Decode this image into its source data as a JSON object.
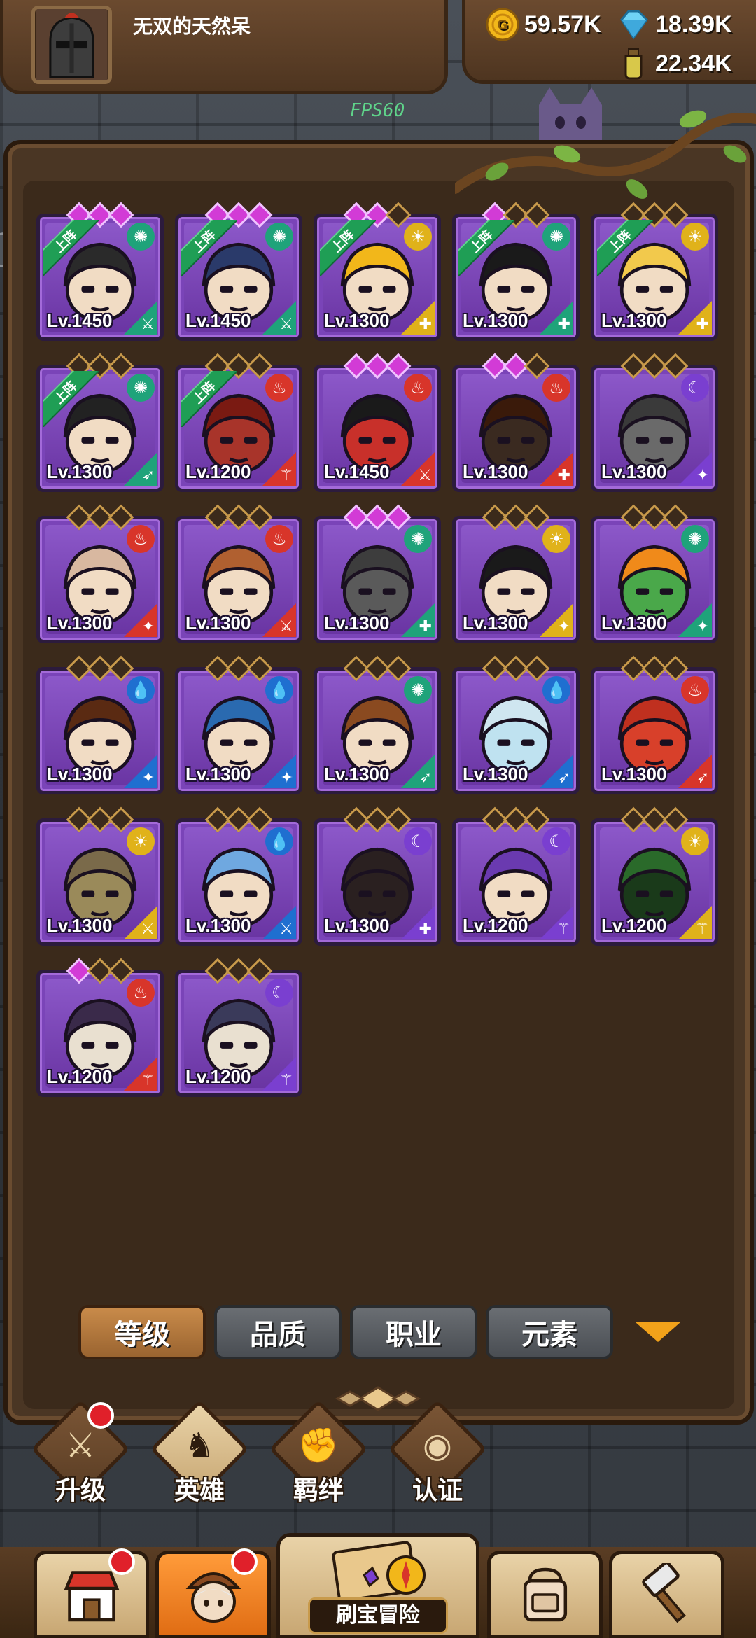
{
  "header": {
    "player_name": "无双的天然呆",
    "fps_label": "FPS60",
    "side_counter": "22",
    "currencies": [
      {
        "name": "gold",
        "value": "59.57K",
        "color": "#f2b71a"
      },
      {
        "name": "diamond",
        "value": "18.39K",
        "color": "#6fd3f5"
      },
      {
        "name": "potion",
        "value": "22.34K",
        "color": "#d8c84a"
      }
    ]
  },
  "heroes": [
    {
      "level": "Lv.1450",
      "stars_lit": 3,
      "deployed": true,
      "deploy_label": "上阵",
      "element": "wind",
      "element_color": "#1fa37a",
      "class": "sword",
      "class_color": "#1fa37a",
      "face": "dark-hair-man"
    },
    {
      "level": "Lv.1450",
      "stars_lit": 3,
      "deployed": true,
      "deploy_label": "上阵",
      "element": "wind",
      "element_color": "#1fa37a",
      "class": "sword",
      "class_color": "#1fa37a",
      "face": "pirate"
    },
    {
      "level": "Lv.1300",
      "stars_lit": 2,
      "deployed": true,
      "deploy_label": "上阵",
      "element": "light",
      "element_color": "#e0b21a",
      "class": "shield",
      "class_color": "#e0b21a",
      "face": "king"
    },
    {
      "level": "Lv.1300",
      "stars_lit": 1,
      "deployed": true,
      "deploy_label": "上阵",
      "element": "wind",
      "element_color": "#1fa37a",
      "class": "shield",
      "class_color": "#1fa37a",
      "face": "headband"
    },
    {
      "level": "Lv.1300",
      "stars_lit": 0,
      "deployed": true,
      "deploy_label": "上阵",
      "element": "light",
      "element_color": "#e0b21a",
      "class": "shield",
      "class_color": "#e0b21a",
      "face": "blonde"
    },
    {
      "level": "Lv.1300",
      "stars_lit": 0,
      "deployed": true,
      "deploy_label": "上阵",
      "element": "wind",
      "element_color": "#1fa37a",
      "class": "bow",
      "class_color": "#1fa37a",
      "face": "ninja"
    },
    {
      "level": "Lv.1200",
      "stars_lit": 0,
      "deployed": true,
      "deploy_label": "上阵",
      "element": "fire",
      "element_color": "#d8352a",
      "class": "staff",
      "class_color": "#d8352a",
      "face": "red-demon"
    },
    {
      "level": "Lv.1450",
      "stars_lit": 3,
      "deployed": false,
      "deploy_label": "",
      "element": "fire",
      "element_color": "#d8352a",
      "class": "sword",
      "class_color": "#d8352a",
      "face": "devil"
    },
    {
      "level": "Lv.1300",
      "stars_lit": 2,
      "deployed": false,
      "deploy_label": "",
      "element": "fire",
      "element_color": "#d8352a",
      "class": "shield",
      "class_color": "#d8352a",
      "face": "afro"
    },
    {
      "level": "Lv.1300",
      "stars_lit": 0,
      "deployed": false,
      "deploy_label": "",
      "element": "dark",
      "element_color": "#7a3fd0",
      "class": "dagger",
      "class_color": "#7a3fd0",
      "face": "goat"
    },
    {
      "level": "Lv.1300",
      "stars_lit": 0,
      "deployed": false,
      "deploy_label": "",
      "element": "fire",
      "element_color": "#d8352a",
      "class": "dagger",
      "class_color": "#d8352a",
      "face": "bald-monk"
    },
    {
      "level": "Lv.1300",
      "stars_lit": 0,
      "deployed": false,
      "deploy_label": "",
      "element": "fire",
      "element_color": "#d8352a",
      "class": "sword",
      "class_color": "#d8352a",
      "face": "turban"
    },
    {
      "level": "Lv.1300",
      "stars_lit": 3,
      "deployed": false,
      "deploy_label": "",
      "element": "wind",
      "element_color": "#1fa37a",
      "class": "shield",
      "class_color": "#1fa37a",
      "face": "knight"
    },
    {
      "level": "Lv.1300",
      "stars_lit": 0,
      "deployed": false,
      "deploy_label": "",
      "element": "light",
      "element_color": "#e0b21a",
      "class": "dagger",
      "class_color": "#e0b21a",
      "face": "masked-king"
    },
    {
      "level": "Lv.1300",
      "stars_lit": 0,
      "deployed": false,
      "deploy_label": "",
      "element": "wind",
      "element_color": "#1fa37a",
      "class": "dagger",
      "class_color": "#1fa37a",
      "face": "orc"
    },
    {
      "level": "Lv.1300",
      "stars_lit": 0,
      "deployed": false,
      "deploy_label": "",
      "element": "water",
      "element_color": "#1f6fd0",
      "class": "dagger",
      "class_color": "#1f6fd0",
      "face": "bun-girl"
    },
    {
      "level": "Lv.1300",
      "stars_lit": 0,
      "deployed": false,
      "deploy_label": "",
      "element": "water",
      "element_color": "#1f6fd0",
      "class": "dagger",
      "class_color": "#1f6fd0",
      "face": "blue-hood"
    },
    {
      "level": "Lv.1300",
      "stars_lit": 0,
      "deployed": false,
      "deploy_label": "",
      "element": "wind",
      "element_color": "#1fa37a",
      "class": "bow",
      "class_color": "#1fa37a",
      "face": "elf"
    },
    {
      "level": "Lv.1300",
      "stars_lit": 0,
      "deployed": false,
      "deploy_label": "",
      "element": "water",
      "element_color": "#1f6fd0",
      "class": "bow",
      "class_color": "#1f6fd0",
      "face": "ice"
    },
    {
      "level": "Lv.1300",
      "stars_lit": 0,
      "deployed": false,
      "deploy_label": "",
      "element": "fire",
      "element_color": "#d8352a",
      "class": "bow",
      "class_color": "#d8352a",
      "face": "red-ogre"
    },
    {
      "level": "Lv.1300",
      "stars_lit": 0,
      "deployed": false,
      "deploy_label": "",
      "element": "light",
      "element_color": "#e0b21a",
      "class": "sword",
      "class_color": "#e0b21a",
      "face": "spartan"
    },
    {
      "level": "Lv.1300",
      "stars_lit": 0,
      "deployed": false,
      "deploy_label": "",
      "element": "water",
      "element_color": "#1f6fd0",
      "class": "sword",
      "class_color": "#1f6fd0",
      "face": "blue-hair"
    },
    {
      "level": "Lv.1300",
      "stars_lit": 0,
      "deployed": false,
      "deploy_label": "",
      "element": "dark",
      "element_color": "#7a3fd0",
      "class": "shield",
      "class_color": "#7a3fd0",
      "face": "dark-demon"
    },
    {
      "level": "Lv.1200",
      "stars_lit": 0,
      "deployed": false,
      "deploy_label": "",
      "element": "dark",
      "element_color": "#7a3fd0",
      "class": "staff",
      "class_color": "#7a3fd0",
      "face": "wizard"
    },
    {
      "level": "Lv.1200",
      "stars_lit": 0,
      "deployed": false,
      "deploy_label": "",
      "element": "light",
      "element_color": "#e0b21a",
      "class": "staff",
      "class_color": "#e0b21a",
      "face": "green-hood"
    },
    {
      "level": "Lv.1200",
      "stars_lit": 1,
      "deployed": false,
      "deploy_label": "",
      "element": "fire",
      "element_color": "#d8352a",
      "class": "staff",
      "class_color": "#d8352a",
      "face": "skull-hood"
    },
    {
      "level": "Lv.1200",
      "stars_lit": 0,
      "deployed": false,
      "deploy_label": "",
      "element": "dark",
      "element_color": "#7a3fd0",
      "class": "staff",
      "class_color": "#7a3fd0",
      "face": "dark-hood"
    }
  ],
  "filters": {
    "tabs": [
      "等级",
      "品质",
      "职业",
      "元素"
    ],
    "active_index": 0
  },
  "subnav": [
    {
      "label": "升级",
      "icon": "sword-upgrade-icon",
      "badge": true,
      "active": false
    },
    {
      "label": "英雄",
      "icon": "hero-icon",
      "badge": false,
      "active": true
    },
    {
      "label": "羁绊",
      "icon": "handshake-icon",
      "badge": false,
      "active": false
    },
    {
      "label": "认证",
      "icon": "eye-icon",
      "badge": false,
      "active": false
    }
  ],
  "bottomnav": {
    "items": [
      {
        "name": "shop",
        "icon": "shop-icon",
        "badge": true,
        "active": false
      },
      {
        "name": "heroes",
        "icon": "hero-portrait-icon",
        "badge": true,
        "active": true
      },
      {
        "name": "adventure",
        "icon": "map-compass-icon",
        "badge": false,
        "active": false
      },
      {
        "name": "bag",
        "icon": "backpack-icon",
        "badge": false,
        "active": false
      },
      {
        "name": "forge",
        "icon": "hammer-icon",
        "badge": false,
        "active": false
      }
    ],
    "center_label": "刷宝冒险"
  }
}
